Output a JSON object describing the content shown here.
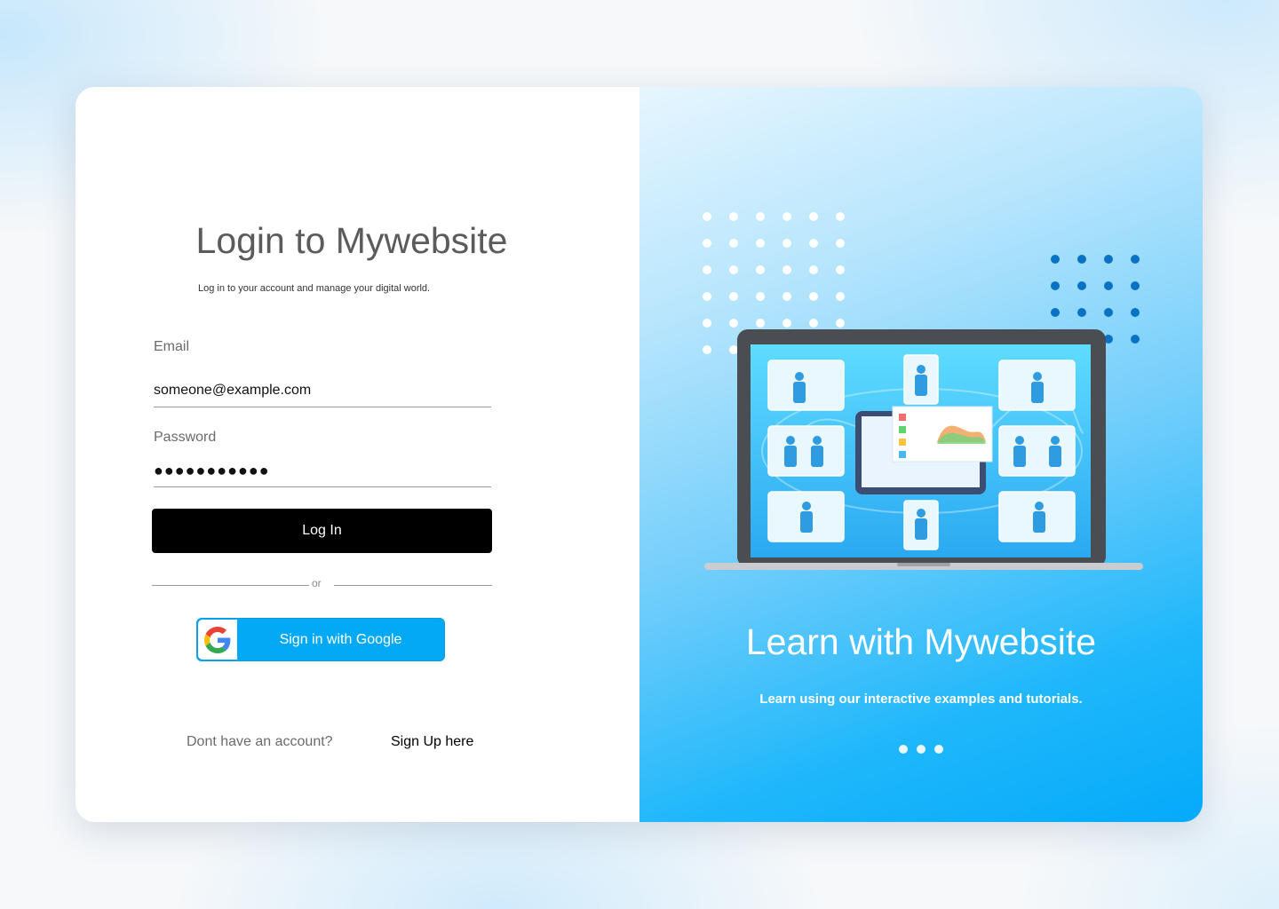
{
  "login": {
    "title": "Login to Mywebsite",
    "subtitle": "Log in to your account and manage your digital world.",
    "email_label": "Email",
    "email_value": "someone@example.com",
    "password_label": "Password",
    "password_mask": "●●●●●●●●●●●",
    "login_button": "Log In",
    "or_text": "or",
    "google_button": "Sign in with Google",
    "no_account_text": "Dont have an account?",
    "signup_link": "Sign Up here"
  },
  "promo": {
    "title": "Learn with Mywebsite",
    "subtitle": "Learn using our interactive examples and tutorials.",
    "carousel_count": 3
  },
  "colors": {
    "primary_button": "#000000",
    "google_button": "#03a9f4",
    "promo_gradient_end": "#05aafa",
    "dot_dark": "#0a72c4"
  },
  "icons": [
    "google-icon",
    "laptop-illustration",
    "dot-pattern"
  ]
}
